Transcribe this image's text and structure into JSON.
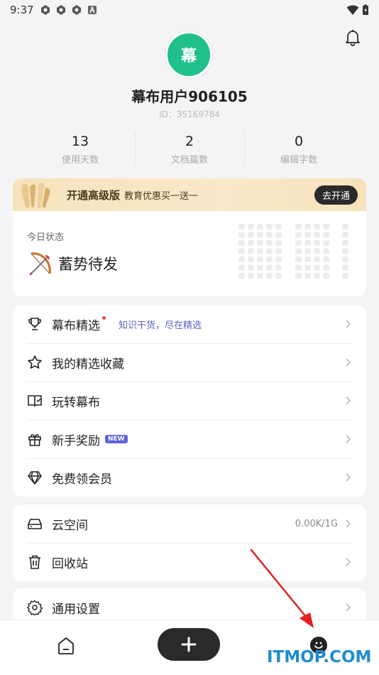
{
  "status_bar": {
    "time": "9:37"
  },
  "profile": {
    "avatar_char": "幕",
    "username": "幕布用户906105",
    "user_id": "ID：35169784"
  },
  "stats": [
    {
      "value": "13",
      "label": "使用天数"
    },
    {
      "value": "2",
      "label": "文档篇数"
    },
    {
      "value": "0",
      "label": "编辑字数"
    }
  ],
  "vip_banner": {
    "title": "开通高级版",
    "subtitle": "教育优惠买一送一",
    "button": "去开通"
  },
  "today": {
    "label": "今日状态",
    "status": "蓄势待发"
  },
  "menu_main": [
    {
      "label": "幕布精选",
      "hint": "知识干货，尽在精选",
      "icon": "trophy-icon"
    },
    {
      "label": "我的精选收藏",
      "icon": "star-icon"
    },
    {
      "label": "玩转幕布",
      "icon": "book-icon"
    },
    {
      "label": "新手奖励",
      "badge": "NEW",
      "icon": "gift-icon"
    },
    {
      "label": "免费领会员",
      "icon": "diamond-icon"
    }
  ],
  "menu_storage": [
    {
      "label": "云空间",
      "value": "0.00K/1G",
      "icon": "drive-icon"
    },
    {
      "label": "回收站",
      "icon": "trash-icon"
    }
  ],
  "menu_settings": [
    {
      "label": "通用设置",
      "icon": "gear-icon"
    }
  ],
  "watermark": "ITMOP.COM",
  "colors": {
    "accent": "#1fc08c",
    "hint": "#5a63c8",
    "badge": "#5b63d9",
    "dark": "#2a2a2a"
  }
}
